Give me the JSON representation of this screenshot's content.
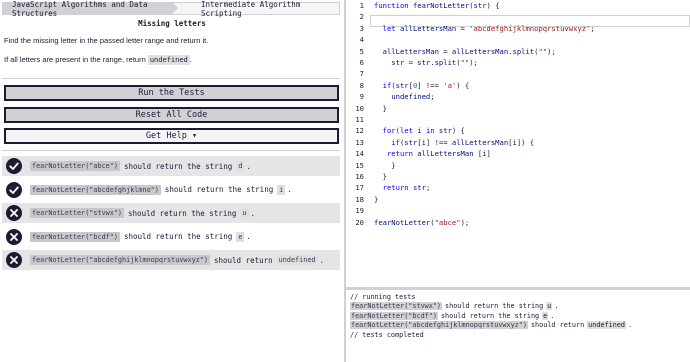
{
  "breadcrumb": {
    "item1": "JavaScript Algorithms and Data Structures",
    "item2": "Intermediate Algorithm Scripting"
  },
  "challenge": {
    "title": "Missing letters",
    "description": "Find the missing letter in the passed letter range and return it.",
    "note_prefix": "If all letters are present in the range, return",
    "note_code": "undefined",
    "note_suffix": "."
  },
  "buttons": {
    "run": "Run the Tests",
    "reset": "Reset All Code",
    "help": "Get Help ▾"
  },
  "tests": [
    {
      "status": "pass",
      "call": "fearNotLetter(\"abce\")",
      "text": "should return the string",
      "value": "d",
      "dot": "."
    },
    {
      "status": "pass",
      "call": "fearNotLetter(\"abcdefghjklmno\")",
      "text": "should return the string",
      "value": "i",
      "dot": "."
    },
    {
      "status": "fail",
      "call": "fearNotLetter(\"stvwx\")",
      "text": "should return the string",
      "value": "u",
      "dot": "."
    },
    {
      "status": "fail",
      "call": "fearNotLetter(\"bcdf\")",
      "text": "should return the string",
      "value": "e",
      "dot": "."
    },
    {
      "status": "fail",
      "call": "fearNotLetter(\"abcdefghijklmnopqrstuvwxyz\")",
      "text": "should return",
      "value": "undefined",
      "dot": "."
    }
  ],
  "editor": {
    "line_numbers": [
      "1",
      "2",
      "3",
      "4",
      "5",
      "6",
      "7",
      "8",
      "9",
      "10",
      "11",
      "12",
      "13",
      "14",
      "15",
      "16",
      "17",
      "18",
      "19",
      "20"
    ],
    "lines": [
      "function fearNotLetter(str) {",
      "",
      "  let allLettersMan = 'abcdefghijklmnopqrstuvwxyz';",
      "",
      "  allLettersMan = allLettersMan.split(\"\");",
      "    str = str.split(\"\");",
      "",
      "  if(str[0] !== 'a') {",
      "    undefined;",
      "  }",
      "",
      "  for(let i in str) {",
      "    if(str[i] !== allLettersMan[i]) {",
      "   return allLettersMan [i]",
      "    }",
      "  }",
      "  return str;",
      "}",
      "",
      "fearNotLetter(\"abce\");"
    ]
  },
  "console": {
    "header": "// running tests",
    "results": [
      {
        "call": "fearNotLetter(\"stvwx\")",
        "text": "should return the string",
        "value": "u",
        "dot": "."
      },
      {
        "call": "fearNotLetter(\"bcdf\")",
        "text": "should return the string",
        "value": "e",
        "dot": "."
      },
      {
        "call": "fearNotLetter(\"abcdefghijklmnopqrstuvwxyz\")",
        "text": "should return",
        "value": "undefined",
        "dot": "."
      }
    ],
    "footer": "// tests completed"
  },
  "colors": {
    "pass_icon": "#1b1b32",
    "fail_icon": "#1b1b32",
    "button_bg": "#d0d0d5",
    "keyword": "#0000ff",
    "string": "#a31515"
  }
}
